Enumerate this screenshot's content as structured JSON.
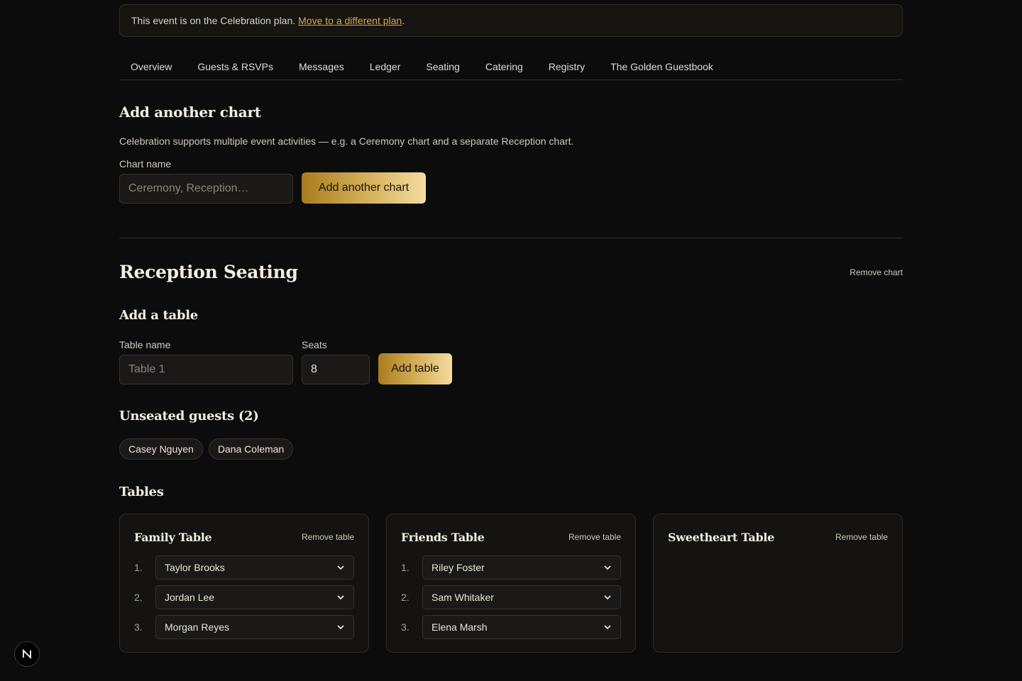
{
  "banner": {
    "text": "This event is on the Celebration plan.",
    "link": "Move to a different plan",
    "suffix": "."
  },
  "tabs": [
    {
      "label": "Overview"
    },
    {
      "label": "Guests & RSVPs"
    },
    {
      "label": "Messages"
    },
    {
      "label": "Ledger"
    },
    {
      "label": "Seating"
    },
    {
      "label": "Catering"
    },
    {
      "label": "Registry"
    },
    {
      "label": "The Golden Guestbook"
    }
  ],
  "add_chart": {
    "title": "Add another chart",
    "description": "Celebration supports multiple event activities — e.g. a Ceremony chart and a separate Reception chart.",
    "name_label": "Chart name",
    "name_placeholder": "Ceremony, Reception…",
    "button": "Add another chart"
  },
  "chart": {
    "title": "Reception Seating",
    "remove": "Remove chart",
    "add_table": {
      "title": "Add a table",
      "name_label": "Table name",
      "name_placeholder": "Table 1",
      "seats_label": "Seats",
      "seats_value": "8",
      "button": "Add table"
    },
    "unseated": {
      "title": "Unseated guests (2)",
      "guests": [
        "Casey Nguyen",
        "Dana Coleman"
      ]
    },
    "tables_title": "Tables",
    "tables": [
      {
        "name": "Family Table",
        "remove": "Remove table",
        "seats": [
          {
            "num": "1.",
            "guest": "Taylor Brooks"
          },
          {
            "num": "2.",
            "guest": "Jordan Lee"
          },
          {
            "num": "3.",
            "guest": "Morgan Reyes"
          }
        ]
      },
      {
        "name": "Friends Table",
        "remove": "Remove table",
        "seats": [
          {
            "num": "1.",
            "guest": "Riley Foster"
          },
          {
            "num": "2.",
            "guest": "Sam Whitaker"
          },
          {
            "num": "3.",
            "guest": "Elena Marsh"
          }
        ]
      },
      {
        "name": "Sweetheart Table",
        "remove": "Remove table",
        "seats": []
      }
    ]
  },
  "dev_badge": {
    "letter": "N"
  },
  "colors": {
    "background": "#0c0c0c",
    "link_gold": "#d9a84a",
    "button_gradient_start": "#a87d1e",
    "button_gradient_end": "#f3dca0"
  }
}
